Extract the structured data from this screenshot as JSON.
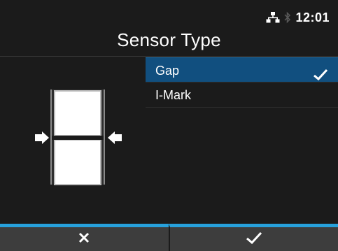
{
  "status": {
    "network_icon": "network-icon",
    "bluetooth_icon": "bluetooth-icon",
    "time": "12:01"
  },
  "header": {
    "title": "Sensor Type"
  },
  "options": [
    {
      "label": "Gap",
      "selected": true
    },
    {
      "label": "I-Mark",
      "selected": false
    }
  ],
  "footer": {
    "cancel_icon": "close-icon",
    "confirm_icon": "check-icon"
  },
  "colors": {
    "background": "#1b1b1b",
    "selection": "#114f7f",
    "accent": "#27a1dc",
    "softkey": "#3d3d3d"
  }
}
